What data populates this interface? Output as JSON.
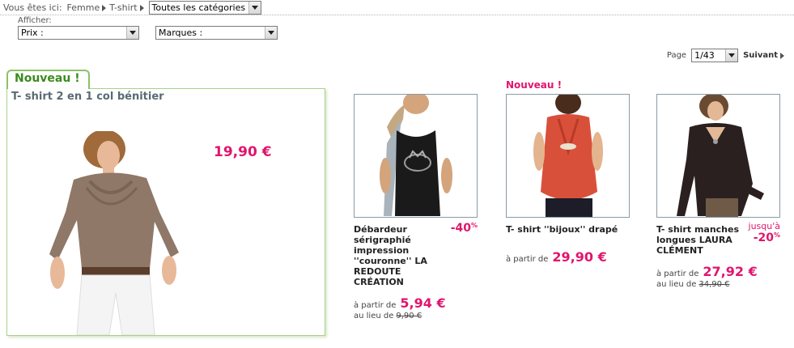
{
  "breadcrumb": {
    "label": "Vous êtes ici:",
    "items": [
      "Femme",
      "T-shirt"
    ],
    "category_select": "Toutes les catégories"
  },
  "filters": {
    "label": "Afficher:",
    "price_select": "Prix :",
    "brand_select": "Marques :"
  },
  "pagination": {
    "label": "Page",
    "current": "1/43",
    "next": "Suivant"
  },
  "featured": {
    "badge": "Nouveau !",
    "title": "T- shirt 2 en 1 col bénitier",
    "price": "19,90 €"
  },
  "products": [
    {
      "name": "Débardeur sérigraphié impression ''couronne'' LA REDOUTE CRÉATION",
      "discount": "-40",
      "discount_unit": "%",
      "from_label": "à partir de",
      "price": "5,94 €",
      "was_label": "au lieu de",
      "old_price": "9,90 €"
    },
    {
      "flag": "Nouveau !",
      "name": "T- shirt ''bijoux'' drapé",
      "from_label": "à partir de",
      "price": "29,90 €"
    },
    {
      "name": "T- shirt manches longues LAURA CLÉMENT",
      "discount_prefix": "jusqu'à",
      "discount": "-20",
      "discount_unit": "%",
      "from_label": "à partir de",
      "price": "27,92 €",
      "was_label": "au lieu de",
      "old_price": "34,90 €"
    }
  ],
  "colors": {
    "accent_pink": "#e0156d",
    "badge_green": "#3b8a1e",
    "frame_green": "#a9cf8e"
  }
}
